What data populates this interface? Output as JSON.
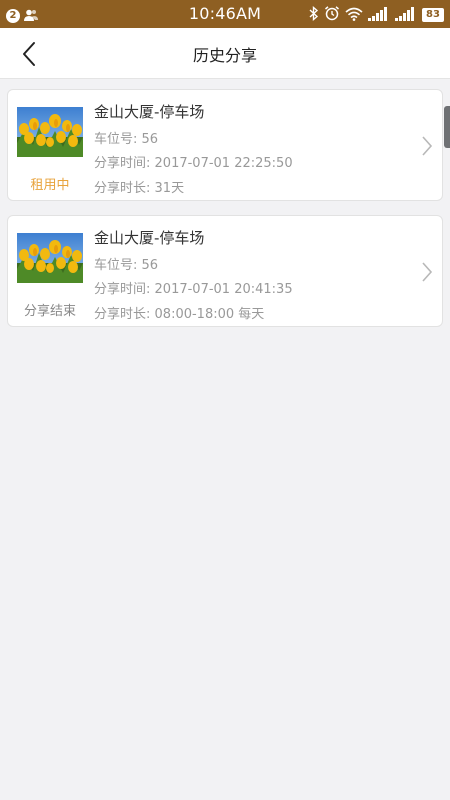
{
  "status_bar": {
    "notification_count": "2",
    "time": "10:46AM",
    "battery": "83"
  },
  "header": {
    "title": "历史分享"
  },
  "cards": [
    {
      "title": "金山大厦-停车场",
      "space_label": "车位号:",
      "space_value": "56",
      "share_time_label": "分享时间:",
      "share_time_value": "2017-07-01 22:25:50",
      "duration_label": "分享时长:",
      "duration_value": "31天",
      "status": "租用中",
      "status_color": "#e8a33c"
    },
    {
      "title": "金山大厦-停车场",
      "space_label": "车位号:",
      "space_value": "56",
      "share_time_label": "分享时间:",
      "share_time_value": "2017-07-01 20:41:35",
      "duration_label": "分享时长:",
      "duration_value": "08:00-18:00 每天",
      "status": "分享结束",
      "status_color": "#888888"
    }
  ],
  "colors": {
    "status_bar_bg": "#8e5f22",
    "page_bg": "#f2f2f4",
    "accent": "#e8a33c"
  }
}
